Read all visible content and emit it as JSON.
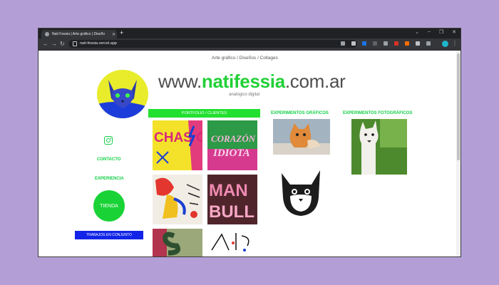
{
  "browser": {
    "tab_title": "Nati Fessia | Arte gráfico | Diseño",
    "tab_close": "✕",
    "new_tab": "+",
    "window_controls": [
      "⌄",
      "–",
      "❐",
      "✕"
    ],
    "back": "←",
    "forward": "→",
    "reload": "↻",
    "url": "nati-fessia.vercel.app",
    "menu": "⋮",
    "colors": {
      "frame": "#202124",
      "toolbar": "#35363a",
      "profile": "#1fb5c9"
    }
  },
  "page": {
    "subtitle": "Arte gráfico / Diseños / Collages",
    "title_prefix": "www.",
    "title_highlight": "natifessia",
    "title_suffix": ".com.ar",
    "tagline": "analógico digital",
    "sidebar": {
      "contacto": "CONTACTO",
      "experiencia": "EXPERIENCIA",
      "tienda": "TIENDA",
      "trabajos": "TRABAJOS EN CONJUNTO"
    },
    "portfolio_label": "PORTFOLIO / CLIENTES",
    "experimentos_graficos": "EXPERIMENTOS GRÁFICOS",
    "experimentos_fotograficos": "EXPERIMENTOS FOTOGRÁFICOS",
    "thumbs": {
      "t1": "CHAS OSAS",
      "t2a": "CORAZÓN",
      "t2b": "IDIOTA",
      "t4a": "MAN",
      "t4b": "BULL"
    },
    "colors": {
      "accent": "#14cf47",
      "green_bar": "#22e02f",
      "blue_button": "#1124e8",
      "background": "#b39fd6"
    }
  }
}
